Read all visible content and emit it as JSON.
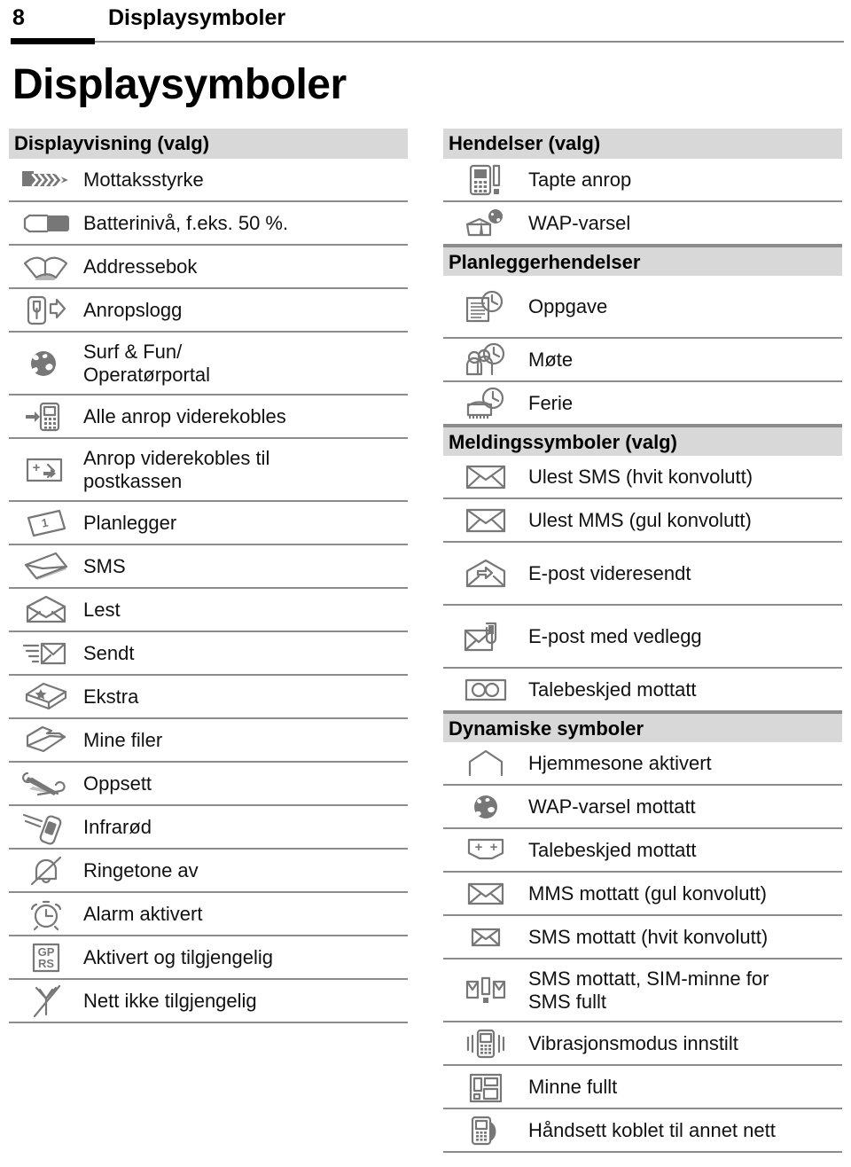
{
  "header": {
    "page_number": "8",
    "chapter": "Displaysymboler"
  },
  "title": "Displaysymboler",
  "columns": {
    "left": [
      {
        "type": "section",
        "label": "Displayvisning (valg)"
      },
      {
        "type": "row",
        "icon": "signal-strength-icon",
        "label": "Mottaksstyrke"
      },
      {
        "type": "row",
        "icon": "battery-level-icon",
        "label": "Batterinivå, f.eks. 50 %."
      },
      {
        "type": "row",
        "icon": "address-book-icon",
        "label": "Addressebok"
      },
      {
        "type": "row",
        "icon": "call-log-icon",
        "label": "Anropslogg"
      },
      {
        "type": "row",
        "icon": "globe-icon",
        "label": "Surf & Fun/\nOperatørportal",
        "tall": true
      },
      {
        "type": "row",
        "icon": "call-divert-all-icon",
        "label": "Alle anrop viderekobles"
      },
      {
        "type": "row",
        "icon": "call-divert-voicemail-icon",
        "label": "Anrop viderekobles til\npostkassen",
        "tall": true
      },
      {
        "type": "row",
        "icon": "organiser-icon",
        "label": "Planlegger"
      },
      {
        "type": "row",
        "icon": "sms-icon",
        "label": "SMS"
      },
      {
        "type": "row",
        "icon": "read-envelope-icon",
        "label": "Lest"
      },
      {
        "type": "row",
        "icon": "sent-envelope-icon",
        "label": "Sendt"
      },
      {
        "type": "row",
        "icon": "extras-box-icon",
        "label": "Ekstra"
      },
      {
        "type": "row",
        "icon": "my-files-folder-icon",
        "label": "Mine filer"
      },
      {
        "type": "row",
        "icon": "settings-tools-icon",
        "label": "Oppsett"
      },
      {
        "type": "row",
        "icon": "infrared-icon",
        "label": "Infrarød"
      },
      {
        "type": "row",
        "icon": "ringer-off-icon",
        "label": "Ringetone av"
      },
      {
        "type": "row",
        "icon": "alarm-clock-icon",
        "label": "Alarm aktivert"
      },
      {
        "type": "row",
        "icon": "gprs-icon",
        "label": "Aktivert og tilgjengelig"
      },
      {
        "type": "row",
        "icon": "no-network-icon",
        "label": "Nett ikke tilgjengelig"
      }
    ],
    "right": [
      {
        "type": "section",
        "label": "Hendelser (valg)"
      },
      {
        "type": "row",
        "icon": "missed-call-icon",
        "label": "Tapte anrop"
      },
      {
        "type": "row",
        "icon": "wap-alert-icon",
        "label": "WAP-varsel"
      },
      {
        "type": "section",
        "label": "Planleggerhendelser"
      },
      {
        "type": "row",
        "icon": "task-icon",
        "label": "Oppgave",
        "tall": true
      },
      {
        "type": "row",
        "icon": "meeting-icon",
        "label": "Møte"
      },
      {
        "type": "row",
        "icon": "holiday-icon",
        "label": "Ferie"
      },
      {
        "type": "section",
        "label": "Meldingssymboler (valg)"
      },
      {
        "type": "row",
        "icon": "unread-sms-white-envelope-icon",
        "label": "Ulest SMS (hvit konvolutt)"
      },
      {
        "type": "row",
        "icon": "unread-mms-yellow-envelope-icon",
        "label": "Ulest MMS (gul konvolutt)"
      },
      {
        "type": "row",
        "icon": "email-forwarded-icon",
        "label": "E-post videresendt",
        "tall": true
      },
      {
        "type": "row",
        "icon": "email-attachment-icon",
        "label": "E-post med vedlegg",
        "tall": true
      },
      {
        "type": "row",
        "icon": "voicemail-tape-icon",
        "label": "Talebeskjed mottatt"
      },
      {
        "type": "section",
        "label": "Dynamiske symboler"
      },
      {
        "type": "row",
        "icon": "home-zone-icon",
        "label": "Hjemmesone aktivert"
      },
      {
        "type": "row",
        "icon": "wap-globe-icon",
        "label": "WAP-varsel mottatt"
      },
      {
        "type": "row",
        "icon": "voicemail-received-icon",
        "label": "Talebeskjed mottatt"
      },
      {
        "type": "row",
        "icon": "mms-received-icon",
        "label": "MMS mottatt (gul konvolutt)"
      },
      {
        "type": "row",
        "icon": "sms-received-icon",
        "label": "SMS mottatt (hvit konvolutt)"
      },
      {
        "type": "row",
        "icon": "sim-memory-full-icon",
        "label": "SMS mottatt, SIM-minne for\nSMS fullt",
        "tall": true
      },
      {
        "type": "row",
        "icon": "vibration-mode-icon",
        "label": "Vibrasjonsmodus innstilt"
      },
      {
        "type": "row",
        "icon": "memory-full-icon",
        "label": "Minne fullt"
      },
      {
        "type": "row",
        "icon": "roaming-handset-icon",
        "label": "Håndsett koblet til annet nett"
      }
    ]
  },
  "colors": {
    "section_background": "#d8d8d8",
    "rule": "#8c8c8c",
    "icon_stroke": "#777777",
    "text": "#000000"
  }
}
